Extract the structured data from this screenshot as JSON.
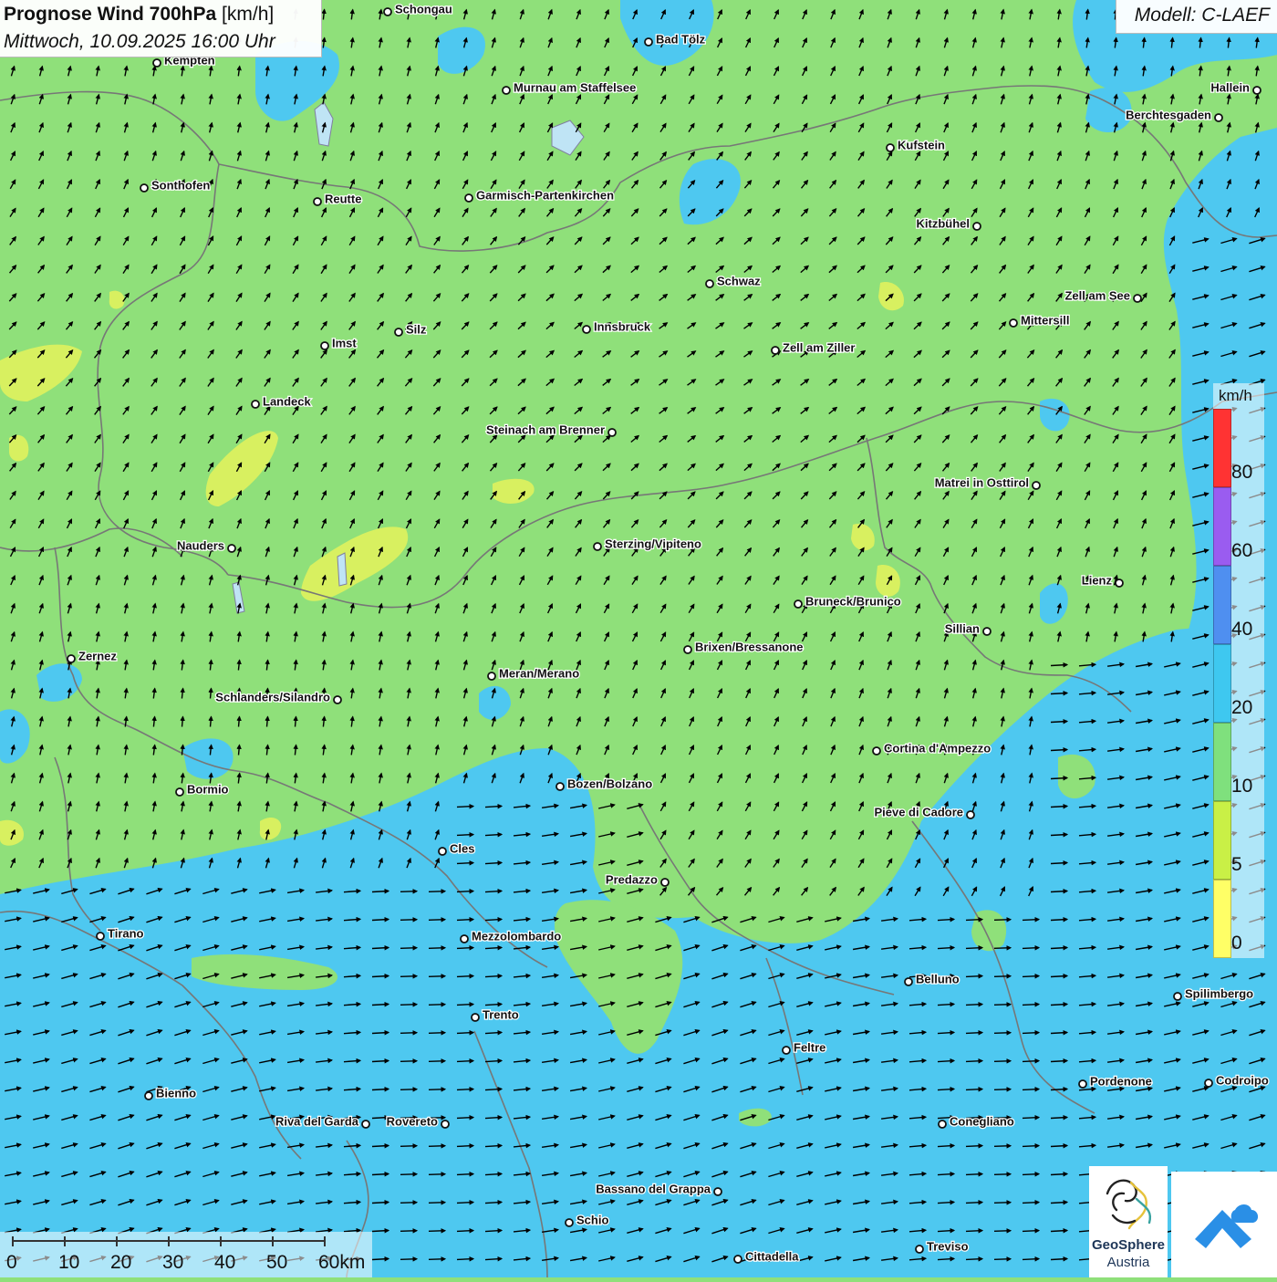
{
  "header": {
    "title_bold": "Prognose Wind 700hPa",
    "title_unit": "[km/h]",
    "subtitle": "Mittwoch, 10.09.2025 16:00 Uhr",
    "model": "Modell: C-LAEF"
  },
  "legend": {
    "unit": "km/h",
    "colors": [
      "#ffff66",
      "#c9f046",
      "#7fe07d",
      "#3ec8f0",
      "#4f8ff0",
      "#9a5cf0",
      "#ff3333"
    ],
    "labels": [
      "0",
      "5",
      "10",
      "20",
      "40",
      "60",
      "80"
    ]
  },
  "scale": {
    "labels": [
      "0",
      "10",
      "20",
      "30",
      "40",
      "50",
      "60km"
    ]
  },
  "logos": {
    "geosphere_line1": "GeoSphere",
    "geosphere_line2": "Austria"
  },
  "wind": {
    "north_direction": "north-northeast",
    "south_direction": "east-northeast",
    "colors": {
      "background": "#8fe07a",
      "faster": "#4ec8f0",
      "slower": "#d8f060",
      "border": "#777777"
    }
  },
  "places": [
    {
      "name": "Schongau",
      "side": "right"
    },
    {
      "name": "Bad Tölz",
      "side": "right"
    },
    {
      "name": "Kempten",
      "side": "right"
    },
    {
      "name": "Murnau am Staffelsee",
      "side": "right"
    },
    {
      "name": "Hallein",
      "side": "left"
    },
    {
      "name": "Berchtesgaden",
      "side": "left"
    },
    {
      "name": "Kufstein",
      "side": "right"
    },
    {
      "name": "Sonthofen",
      "side": "right"
    },
    {
      "name": "Reutte",
      "side": "right"
    },
    {
      "name": "Garmisch-Partenkirchen",
      "side": "right"
    },
    {
      "name": "Kitzbühel",
      "side": "left"
    },
    {
      "name": "Schwaz",
      "side": "right"
    },
    {
      "name": "Zell am See",
      "side": "left"
    },
    {
      "name": "Mittersill",
      "side": "right"
    },
    {
      "name": "Innsbruck",
      "side": "right"
    },
    {
      "name": "Zell am Ziller",
      "side": "right"
    },
    {
      "name": "Imst",
      "side": "right"
    },
    {
      "name": "Silz",
      "side": "right"
    },
    {
      "name": "Landeck",
      "side": "right"
    },
    {
      "name": "Steinach am Brenner",
      "side": "left"
    },
    {
      "name": "Matrei in Osttirol",
      "side": "left"
    },
    {
      "name": "Nauders",
      "side": "left"
    },
    {
      "name": "Sterzing/Vipiteno",
      "side": "right"
    },
    {
      "name": "Lienz",
      "side": "left"
    },
    {
      "name": "Bruneck/Brunico",
      "side": "right"
    },
    {
      "name": "Sillian",
      "side": "left"
    },
    {
      "name": "Brixen/Bressanone",
      "side": "right"
    },
    {
      "name": "Zernez",
      "side": "right"
    },
    {
      "name": "Meran/Merano",
      "side": "right"
    },
    {
      "name": "Schlanders/Silandro",
      "side": "left"
    },
    {
      "name": "Cortina d'Ampezzo",
      "side": "right"
    },
    {
      "name": "Bozen/Bolzano",
      "side": "right"
    },
    {
      "name": "Bormio",
      "side": "right"
    },
    {
      "name": "Pieve di Cadore",
      "side": "left"
    },
    {
      "name": "Cles",
      "side": "right"
    },
    {
      "name": "Predazzo",
      "side": "left"
    },
    {
      "name": "Tirano",
      "side": "right"
    },
    {
      "name": "Mezzolombardo",
      "side": "right"
    },
    {
      "name": "Belluno",
      "side": "right"
    },
    {
      "name": "Spilimbergo",
      "side": "right"
    },
    {
      "name": "Trento",
      "side": "right"
    },
    {
      "name": "Feltre",
      "side": "right"
    },
    {
      "name": "Bienno",
      "side": "right"
    },
    {
      "name": "Pordenone",
      "side": "right"
    },
    {
      "name": "Codroipo",
      "side": "right"
    },
    {
      "name": "Riva del Garda",
      "side": "left"
    },
    {
      "name": "Rovereto",
      "side": "left"
    },
    {
      "name": "Conegliano",
      "side": "right"
    },
    {
      "name": "Bassano del Grappa",
      "side": "left"
    },
    {
      "name": "Schio",
      "side": "right"
    },
    {
      "name": "Treviso",
      "side": "right"
    },
    {
      "name": "Cittadella",
      "side": "right"
    }
  ]
}
